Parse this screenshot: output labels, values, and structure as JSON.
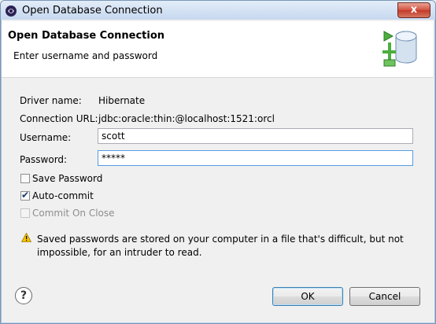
{
  "window": {
    "title": "Open Database Connection",
    "close_label": "x"
  },
  "banner": {
    "title": "Open Database Connection",
    "subtitle": "Enter username and password"
  },
  "form": {
    "driver_label": "Driver name:",
    "driver_value": "Hibernate",
    "url_label": "Connection URL:",
    "url_value": "jdbc:oracle:thin:@localhost:1521:orcl",
    "username_label": "Username:",
    "username_value": "scott",
    "password_label": "Password:",
    "password_value": "*****"
  },
  "options": {
    "save_password_label": "Save Password",
    "save_password_checked": false,
    "auto_commit_label": "Auto-commit",
    "auto_commit_checked": true,
    "commit_on_close_label": "Commit On Close",
    "commit_on_close_checked": false,
    "commit_on_close_enabled": false
  },
  "warning": {
    "text": "Saved passwords are stored on your computer in a file that's difficult, but not impossible, for an intruder to read."
  },
  "buttons": {
    "help_label": "?",
    "ok_label": "OK",
    "cancel_label": "Cancel"
  },
  "colors": {
    "titlebar": "#c6d8ef",
    "close_button": "#c23a27",
    "warning_icon": "#f5c400",
    "db_icon_green": "#4cae3f"
  }
}
